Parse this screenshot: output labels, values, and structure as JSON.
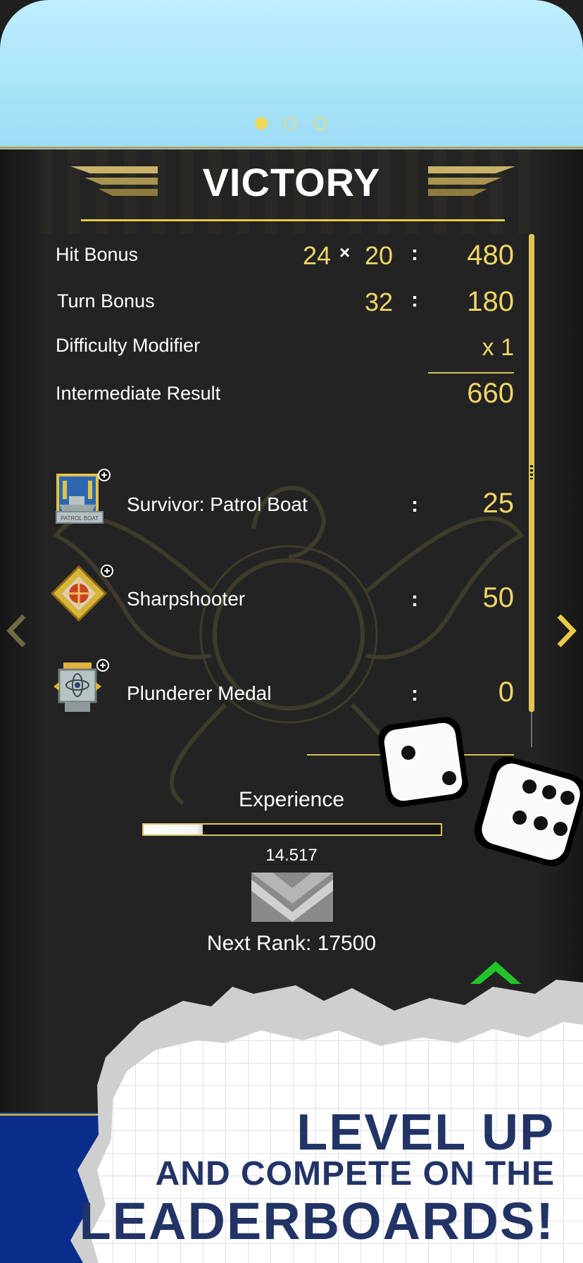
{
  "page_indicator": {
    "total": 3,
    "active_index": 0
  },
  "result": {
    "title": "VICTORY",
    "hit_bonus": {
      "label": "Hit Bonus",
      "hits": "24",
      "times": "×",
      "multiplier": "20",
      "colon": ":",
      "total": "480"
    },
    "turn_bonus": {
      "label": "Turn Bonus",
      "turns": "32",
      "colon": ":",
      "total": "180"
    },
    "difficulty": {
      "label": "Difficulty Modifier",
      "value": "x 1"
    },
    "intermediate": {
      "label": "Intermediate Result",
      "value": "660"
    }
  },
  "medals": [
    {
      "name": "Survivor: Patrol Boat",
      "colon": ":",
      "points": "25",
      "icon": "patrol-boat-medal-icon",
      "icon_caption": "PATROL BOAT"
    },
    {
      "name": "Sharpshooter",
      "colon": ":",
      "points": "50",
      "icon": "sharpshooter-medal-icon"
    },
    {
      "name": "Plunderer Medal",
      "colon": ":",
      "points": "0",
      "icon": "plunderer-medal-icon"
    }
  ],
  "experience": {
    "label": "Experience",
    "value": "14.517",
    "progress_fraction": 0.2,
    "next_rank_label": "Next Rank: 17500"
  },
  "promo": {
    "line1": "LEVEL UP",
    "line2": "AND COMPETE ON THE",
    "line3": "LEADERBOARDS!"
  },
  "colors": {
    "accent": "#f0d667",
    "panel": "#232323",
    "promo_text": "#223366",
    "bottom_bar": "#0b2d8a"
  }
}
